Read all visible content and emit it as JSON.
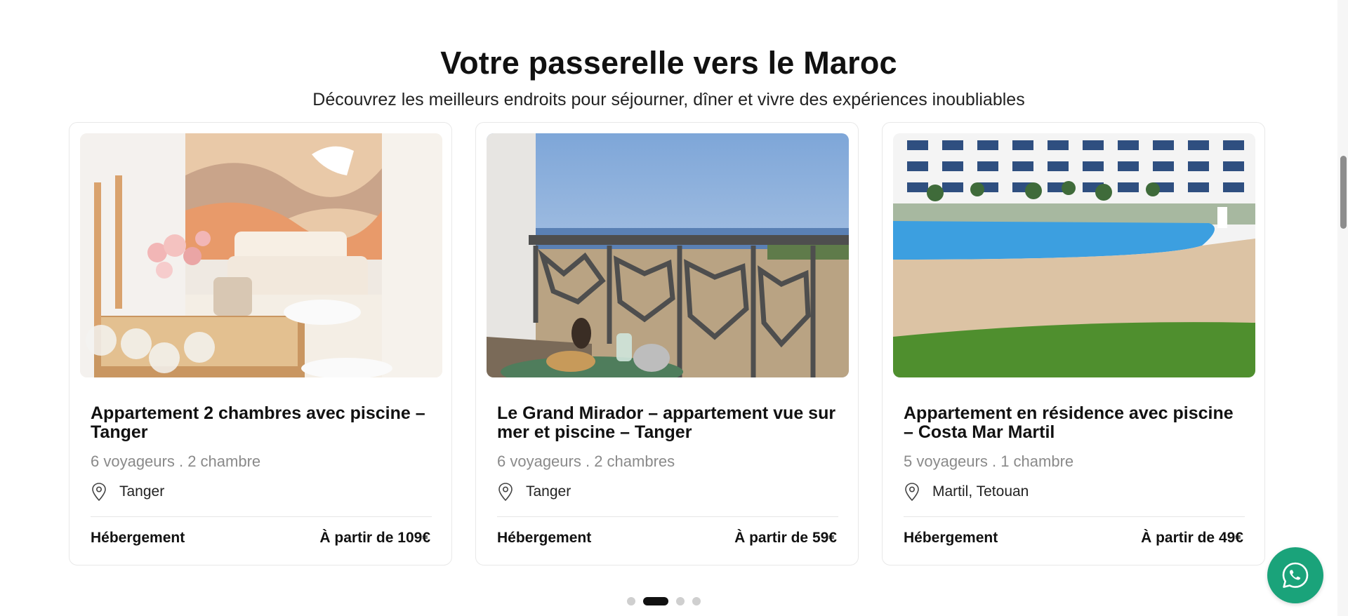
{
  "section": {
    "title": "Votre passerelle vers le Maroc",
    "subtitle": "Découvrez les meilleurs endroits pour séjourner, dîner et vivre des expériences inoubliables"
  },
  "cards": [
    {
      "title": "Appartement 2 chambres avec piscine – Tanger",
      "meta": "6 voyageurs . 2 chambre",
      "location": "Tanger",
      "category": "Hébergement",
      "price": "À partir de 109€",
      "image_icon": "interior-living-room-photo"
    },
    {
      "title": "Le Grand Mirador – appartement vue sur mer et piscine – Tanger",
      "meta": "6 voyageurs . 2 chambres",
      "location": "Tanger",
      "category": "Hébergement",
      "price": "À partir de 59€",
      "image_icon": "balcony-sea-view-photo"
    },
    {
      "title": "Appartement en résidence avec piscine – Costa Mar Martil",
      "meta": "5 voyageurs . 1 chambre",
      "location": "Martil, Tetouan",
      "category": "Hébergement",
      "price": "À partir de 49€",
      "image_icon": "residence-pool-photo"
    }
  ],
  "pagination": {
    "count": 4,
    "active_index": 1
  },
  "colors": {
    "whatsapp": "#1aa37a",
    "dot_active": "#111111",
    "dot_inactive": "#cfcfcf"
  },
  "icons": {
    "location": "map-pin-icon",
    "whatsapp": "whatsapp-icon"
  }
}
